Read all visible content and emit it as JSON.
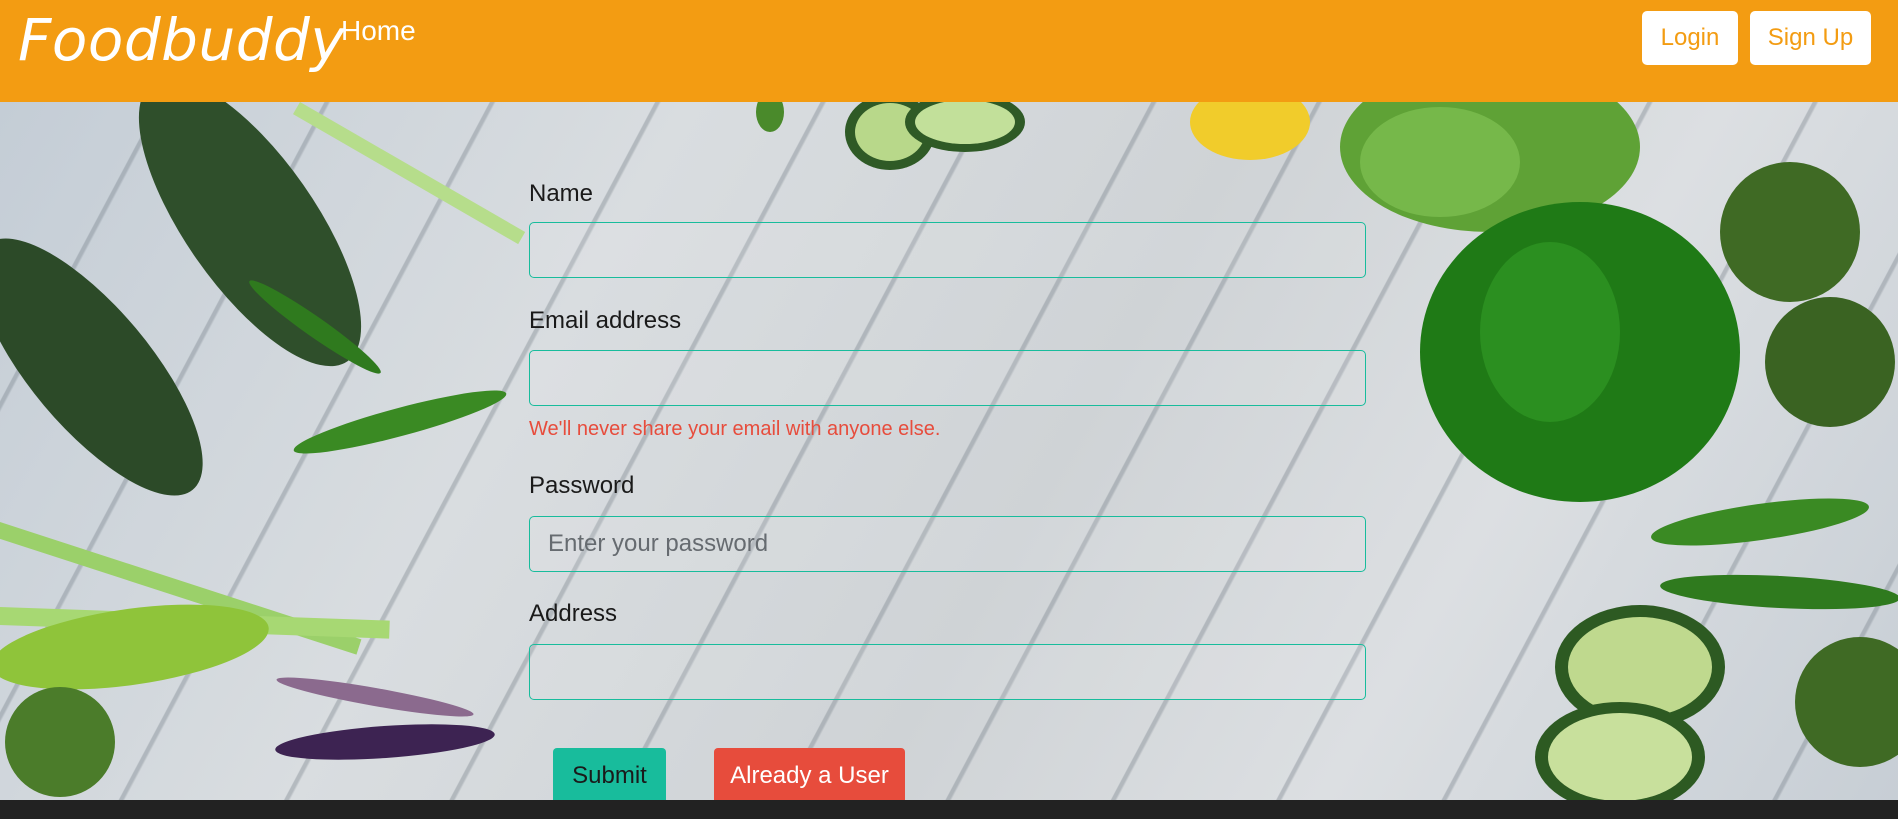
{
  "navbar": {
    "brand": "Foodbuddy",
    "home_link": "Home",
    "login_label": "Login",
    "signup_label": "Sign Up"
  },
  "form": {
    "name_label": "Name",
    "name_value": "",
    "email_label": "Email address",
    "email_value": "",
    "email_help": "We'll never share your email with anyone else.",
    "password_label": "Password",
    "password_placeholder": "Enter your password",
    "address_label": "Address",
    "address_value": "",
    "submit_label": "Submit",
    "already_user_label": "Already a User"
  },
  "colors": {
    "navbar": "#f39c12",
    "success": "#18bc9c",
    "danger": "#e74c3c",
    "footer": "#222222"
  }
}
